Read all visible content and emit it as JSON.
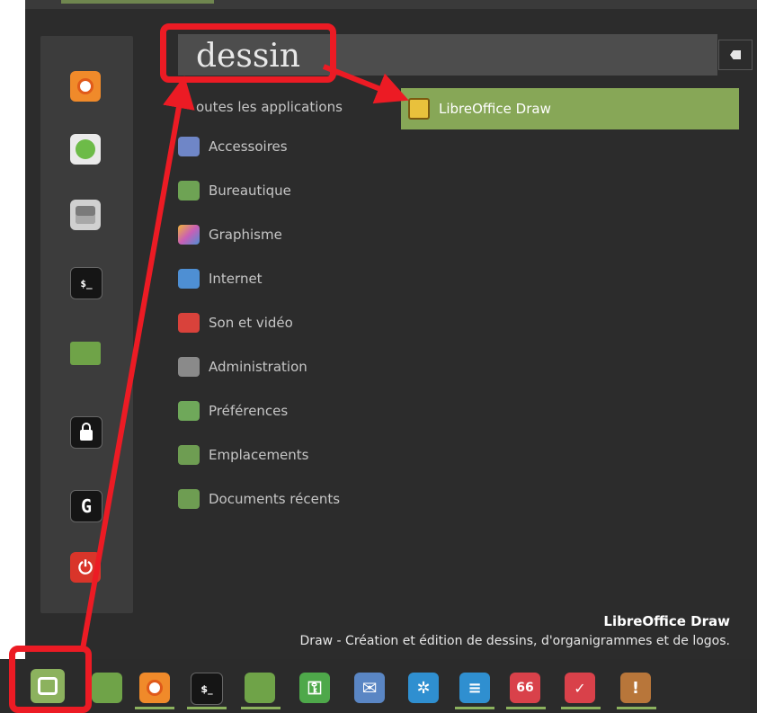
{
  "search": {
    "value": "dessin"
  },
  "categories": {
    "all": "outes les applications",
    "items": [
      {
        "label": "Accessoires",
        "icon": "accessories-icon",
        "color": "#6f86c7"
      },
      {
        "label": "Bureautique",
        "icon": "office-icon",
        "color": "#6ea354"
      },
      {
        "label": "Graphisme",
        "icon": "graphics-icon",
        "color": "#c85fb6"
      },
      {
        "label": "Internet",
        "icon": "internet-icon",
        "color": "#4e8fd3"
      },
      {
        "label": "Son et vidéo",
        "icon": "sound-video-icon",
        "color": "#d9423b"
      },
      {
        "label": "Administration",
        "icon": "administration-icon",
        "color": "#8a8a8a"
      },
      {
        "label": "Préférences",
        "icon": "preferences-icon",
        "color": "#6fa85a"
      },
      {
        "label": "Emplacements",
        "icon": "places-icon",
        "color": "#6e9d52"
      },
      {
        "label": "Documents récents",
        "icon": "recent-documents-icon",
        "color": "#6e9d52"
      }
    ]
  },
  "result": {
    "label": "LibreOffice Draw"
  },
  "description": {
    "title": "LibreOffice Draw",
    "text": "Draw - Création et édition de dessins, d'organigrammes et de logos."
  },
  "favorites": [
    {
      "name": "firefox-icon",
      "color": "#f08a2a"
    },
    {
      "name": "software-manager-icon",
      "color": "#6dbb48"
    },
    {
      "name": "system-settings-icon",
      "color": "#c9c9c9"
    },
    {
      "name": "terminal-icon",
      "color": "#1a1a1a"
    },
    {
      "name": "files-icon",
      "color": "#6fa348"
    },
    {
      "name": "lock-screen-icon",
      "color": "#1a1a1a"
    },
    {
      "name": "logout-icon",
      "color": "#1a1a1a"
    },
    {
      "name": "shutdown-icon",
      "color": "#d9352a"
    }
  ],
  "taskbar": [
    {
      "name": "mint-menu-icon",
      "color": "#8cb25e"
    },
    {
      "name": "show-desktop-icon",
      "color": "#6fa348"
    },
    {
      "name": "firefox-icon",
      "color": "#f08a2a"
    },
    {
      "name": "terminal-icon",
      "color": "#1a1a1a"
    },
    {
      "name": "files-icon",
      "color": "#6fa348"
    },
    {
      "name": "keepass-icon",
      "color": "#4ea84a"
    },
    {
      "name": "mail-icon",
      "color": "#5a86c4"
    },
    {
      "name": "software-center-icon",
      "color": "#2f8fd0"
    },
    {
      "name": "text-editor-icon",
      "color": "#2f8fd0"
    },
    {
      "name": "reader-icon",
      "color": "#d9414a"
    },
    {
      "name": "system-reports-icon",
      "color": "#d9414a"
    },
    {
      "name": "archive-icon",
      "color": "#b8763a"
    }
  ]
}
